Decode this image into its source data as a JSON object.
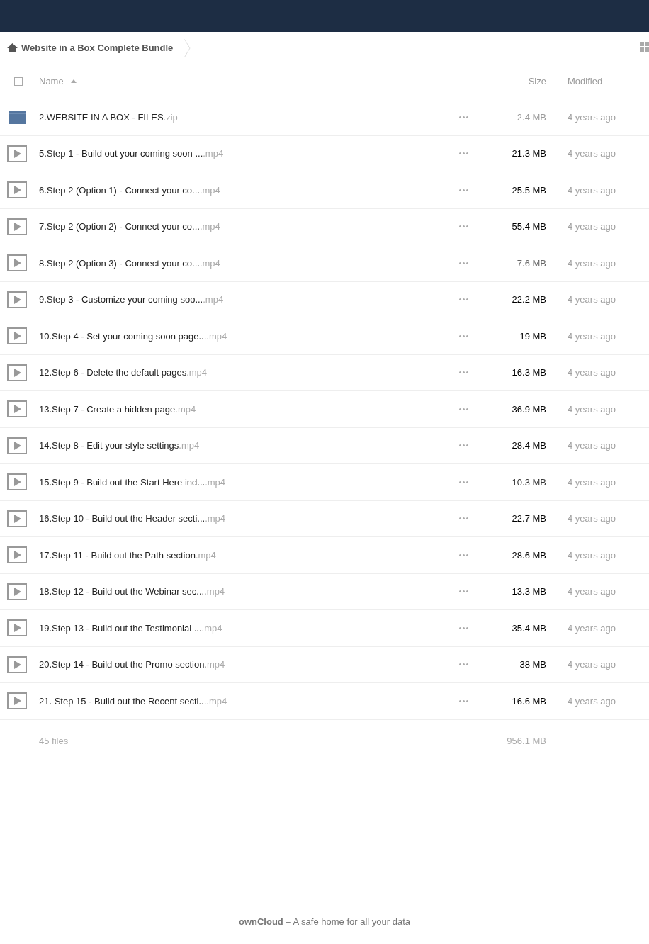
{
  "breadcrumb": {
    "items": [
      {
        "label": "Website in a Box Complete Bundle"
      }
    ]
  },
  "table": {
    "select_all": {
      "checked": false
    },
    "columns": [
      {
        "label": "Name",
        "sorted": true
      },
      {
        "label": "Size",
        "sorted": false
      },
      {
        "label": "Modified",
        "sorted": false
      }
    ],
    "files": [
      {
        "kind": "archive",
        "name": "2.WEBSITE IN A BOX - FILES",
        "extension": ".zip",
        "size": "2.4 MB",
        "color": "#9a9a9a",
        "modified": "4 years ago"
      },
      {
        "kind": "video",
        "name": "5.Step 1 - Build out your coming soon ...",
        "extension": ".mp4",
        "size": "21.3 MB",
        "color": "#000000",
        "modified": "4 years ago"
      },
      {
        "kind": "video",
        "name": "6.Step 2 (Option 1) - Connect your co...",
        "extension": ".mp4",
        "size": "25.5 MB",
        "color": "#000000",
        "modified": "4 years ago"
      },
      {
        "kind": "video",
        "name": "7.Step 2 (Option 2) - Connect your co...",
        "extension": ".mp4",
        "size": "55.4 MB",
        "color": "#000000",
        "modified": "4 years ago"
      },
      {
        "kind": "video",
        "name": "8.Step 2 (Option 3) - Connect your co...",
        "extension": ".mp4",
        "size": "7.6 MB",
        "color": "#666666",
        "modified": "4 years ago"
      },
      {
        "kind": "video",
        "name": "9.Step 3 - Customize your coming soo...",
        "extension": ".mp4",
        "size": "22.2 MB",
        "color": "#000000",
        "modified": "4 years ago"
      },
      {
        "kind": "video",
        "name": "10.Step 4 - Set your coming soon page...",
        "extension": ".mp4",
        "size": "19 MB",
        "color": "#000000",
        "modified": "4 years ago"
      },
      {
        "kind": "video",
        "name": "12.Step 6 - Delete the default pages",
        "extension": ".mp4",
        "size": "16.3 MB",
        "color": "#000000",
        "modified": "4 years ago"
      },
      {
        "kind": "video",
        "name": "13.Step 7 - Create a hidden page",
        "extension": ".mp4",
        "size": "36.9 MB",
        "color": "#000000",
        "modified": "4 years ago"
      },
      {
        "kind": "video",
        "name": "14.Step 8 - Edit your style settings",
        "extension": ".mp4",
        "size": "28.4 MB",
        "color": "#000000",
        "modified": "4 years ago"
      },
      {
        "kind": "video",
        "name": "15.Step 9 - Build out the Start Here ind...",
        "extension": ".mp4",
        "size": "10.3 MB",
        "color": "#363636",
        "modified": "4 years ago"
      },
      {
        "kind": "video",
        "name": "16.Step 10 - Build out the Header secti...",
        "extension": ".mp4",
        "size": "22.7 MB",
        "color": "#000000",
        "modified": "4 years ago"
      },
      {
        "kind": "video",
        "name": "17.Step 11 - Build out the Path section",
        "extension": ".mp4",
        "size": "28.6 MB",
        "color": "#000000",
        "modified": "4 years ago"
      },
      {
        "kind": "video",
        "name": "18.Step 12 - Build out the Webinar sec...",
        "extension": ".mp4",
        "size": "13.3 MB",
        "color": "#000000",
        "modified": "4 years ago"
      },
      {
        "kind": "video",
        "name": "19.Step 13 - Build out the Testimonial ...",
        "extension": ".mp4",
        "size": "35.4 MB",
        "color": "#000000",
        "modified": "4 years ago"
      },
      {
        "kind": "video",
        "name": "20.Step 14 - Build out the Promo section",
        "extension": ".mp4",
        "size": "38 MB",
        "color": "#000000",
        "modified": "4 years ago"
      },
      {
        "kind": "video",
        "name": "21. Step 15 - Build out the Recent secti...",
        "extension": ".mp4",
        "size": "16.6 MB",
        "color": "#000000",
        "modified": "4 years ago"
      }
    ],
    "summary": {
      "count": "45 files",
      "total_size": "956.1 MB"
    }
  },
  "footer": {
    "text": "**ownCloud** – A safe home for all your data"
  }
}
